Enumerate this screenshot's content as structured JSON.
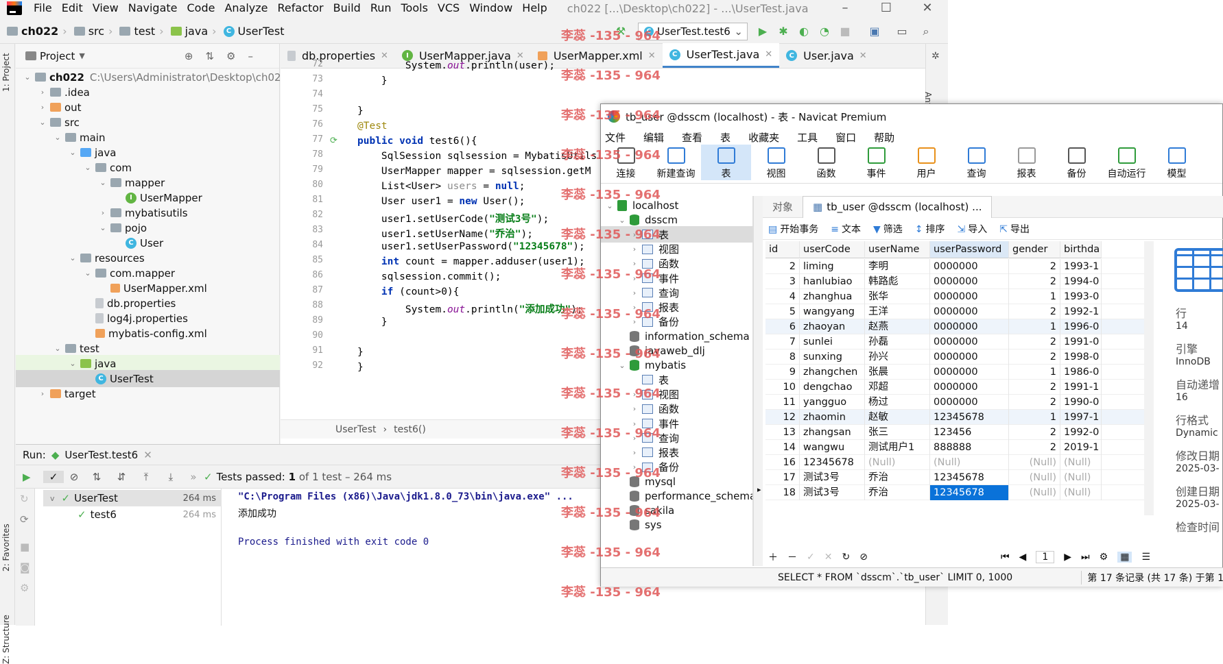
{
  "ide": {
    "menu": [
      "File",
      "Edit",
      "View",
      "Navigate",
      "Code",
      "Analyze",
      "Refactor",
      "Build",
      "Run",
      "Tools",
      "VCS",
      "Window",
      "Help"
    ],
    "window_title": "ch022 [...\\Desktop\\ch022] - ...\\UserTest.java",
    "breadcrumb": [
      "ch022",
      "src",
      "test",
      "java",
      "UserTest"
    ],
    "run_config": "UserTest.test6",
    "project_label": "Project",
    "vertical_tabs": {
      "project": "1: Project",
      "favorites": "2: Favorites",
      "structure": "Z: Structure",
      "ant": "Ant"
    },
    "tree": [
      {
        "label": "ch022",
        "extra": "C:\\Users\\Administrator\\Desktop\\ch022",
        "indent": 0,
        "arrow": "v",
        "icon": "folder"
      },
      {
        "label": ".idea",
        "indent": 1,
        "arrow": ">",
        "icon": "folder"
      },
      {
        "label": "out",
        "indent": 1,
        "arrow": ">",
        "icon": "folder-orange"
      },
      {
        "label": "src",
        "indent": 1,
        "arrow": "v",
        "icon": "folder"
      },
      {
        "label": "main",
        "indent": 2,
        "arrow": "v",
        "icon": "folder"
      },
      {
        "label": "java",
        "indent": 3,
        "arrow": "v",
        "icon": "folder-blue"
      },
      {
        "label": "com",
        "indent": 4,
        "arrow": "v",
        "icon": "folder"
      },
      {
        "label": "mapper",
        "indent": 5,
        "arrow": "v",
        "icon": "folder"
      },
      {
        "label": "UserMapper",
        "indent": 6,
        "arrow": "",
        "icon": "interface"
      },
      {
        "label": "mybatisutils",
        "indent": 5,
        "arrow": ">",
        "icon": "folder"
      },
      {
        "label": "pojo",
        "indent": 5,
        "arrow": "v",
        "icon": "folder"
      },
      {
        "label": "User",
        "indent": 6,
        "arrow": "",
        "icon": "class"
      },
      {
        "label": "resources",
        "indent": 3,
        "arrow": "v",
        "icon": "folder"
      },
      {
        "label": "com.mapper",
        "indent": 4,
        "arrow": "v",
        "icon": "folder"
      },
      {
        "label": "UserMapper.xml",
        "indent": 5,
        "arrow": "",
        "icon": "xml"
      },
      {
        "label": "db.properties",
        "indent": 4,
        "arrow": "",
        "icon": "file"
      },
      {
        "label": "log4j.properties",
        "indent": 4,
        "arrow": "",
        "icon": "file"
      },
      {
        "label": "mybatis-config.xml",
        "indent": 4,
        "arrow": "",
        "icon": "xml"
      },
      {
        "label": "test",
        "indent": 2,
        "arrow": "v",
        "icon": "folder"
      },
      {
        "label": "java",
        "indent": 3,
        "arrow": "v",
        "icon": "folder-green"
      },
      {
        "label": "UserTest",
        "indent": 4,
        "arrow": "",
        "icon": "class"
      },
      {
        "label": "target",
        "indent": 1,
        "arrow": ">",
        "icon": "folder-orange"
      }
    ],
    "tabs": [
      {
        "label": "db.properties",
        "icon": "file"
      },
      {
        "label": "UserMapper.java",
        "icon": "interface"
      },
      {
        "label": "UserMapper.xml",
        "icon": "xml"
      },
      {
        "label": "UserTest.java",
        "icon": "class",
        "active": true
      },
      {
        "label": "User.java",
        "icon": "class"
      }
    ],
    "line_numbers": [
      "72",
      "73",
      "74",
      "75",
      "76",
      "77",
      "78",
      "79",
      "80",
      "81",
      "82",
      "83",
      "84",
      "85",
      "86",
      "87",
      "88",
      "89",
      "90",
      "91",
      "92"
    ],
    "code_lines": [
      "        System.out.println(user);",
      "    }",
      "",
      "}",
      "@Test",
      "public void test6(){",
      "    SqlSession sqlsession = MybatisUtils.",
      "    UserMapper mapper = sqlsession.getM",
      "    List<User> users = null;",
      "    User user1 = new User();",
      "    user1.setUserCode(\"测试3号\");",
      "    user1.setUserName(\"乔治\");",
      "    user1.setUserPassword(\"12345678\");",
      "    int count = mapper.adduser(user1);",
      "    sqlsession.commit();",
      "    if (count>0){",
      "        System.out.println(\"添加成功\");",
      "    }",
      "",
      "}",
      "}"
    ],
    "editor_crumb": [
      "UserTest",
      "test6()"
    ],
    "run": {
      "label": "Run:",
      "tab": "UserTest.test6",
      "status": "Tests passed:",
      "status_count": "1",
      "status_rest": "of 1 test – 264 ms",
      "tree": [
        {
          "label": "UserTest",
          "time": "264 ms"
        },
        {
          "label": "test6",
          "time": "264 ms"
        }
      ],
      "output": [
        "\"C:\\Program Files (x86)\\Java\\jdk1.8.0_73\\bin\\java.exe\" ...",
        "添加成功",
        "",
        "Process finished with exit code 0"
      ]
    }
  },
  "navicat": {
    "title": "tb_user @dsscm (localhost) - 表 - Navicat Premium",
    "menu": [
      "文件",
      "编辑",
      "查看",
      "表",
      "收藏夹",
      "工具",
      "窗口",
      "帮助"
    ],
    "toolbar": [
      "连接",
      "新建查询",
      "表",
      "视图",
      "函数",
      "事件",
      "用户",
      "查询",
      "报表",
      "备份",
      "自动运行",
      "模型"
    ],
    "tree": [
      {
        "label": "localhost",
        "indent": 0,
        "arrow": "v",
        "icon": "server"
      },
      {
        "label": "dsscm",
        "indent": 1,
        "arrow": "v",
        "icon": "db-green"
      },
      {
        "label": "表",
        "indent": 2,
        "arrow": ">",
        "icon": "table",
        "selected": true
      },
      {
        "label": "视图",
        "indent": 2,
        "arrow": ">",
        "icon": "view"
      },
      {
        "label": "函数",
        "indent": 2,
        "arrow": ">",
        "icon": "func"
      },
      {
        "label": "事件",
        "indent": 2,
        "arrow": ">",
        "icon": "event"
      },
      {
        "label": "查询",
        "indent": 2,
        "arrow": ">",
        "icon": "query"
      },
      {
        "label": "报表",
        "indent": 2,
        "arrow": ">",
        "icon": "report"
      },
      {
        "label": "备份",
        "indent": 2,
        "arrow": ">",
        "icon": "backup"
      },
      {
        "label": "information_schema",
        "indent": 1,
        "arrow": "",
        "icon": "db"
      },
      {
        "label": "javaweb_dlj",
        "indent": 1,
        "arrow": "",
        "icon": "db"
      },
      {
        "label": "mybatis",
        "indent": 1,
        "arrow": "v",
        "icon": "db-green"
      },
      {
        "label": "表",
        "indent": 2,
        "arrow": "",
        "icon": "table"
      },
      {
        "label": "视图",
        "indent": 2,
        "arrow": ">",
        "icon": "view"
      },
      {
        "label": "函数",
        "indent": 2,
        "arrow": ">",
        "icon": "func"
      },
      {
        "label": "事件",
        "indent": 2,
        "arrow": ">",
        "icon": "event"
      },
      {
        "label": "查询",
        "indent": 2,
        "arrow": ">",
        "icon": "query"
      },
      {
        "label": "报表",
        "indent": 2,
        "arrow": ">",
        "icon": "report"
      },
      {
        "label": "备份",
        "indent": 2,
        "arrow": ">",
        "icon": "backup"
      },
      {
        "label": "mysql",
        "indent": 1,
        "arrow": "",
        "icon": "db"
      },
      {
        "label": "performance_schema",
        "indent": 1,
        "arrow": "",
        "icon": "db"
      },
      {
        "label": "sakila",
        "indent": 1,
        "arrow": "",
        "icon": "db"
      },
      {
        "label": "sys",
        "indent": 1,
        "arrow": "",
        "icon": "db"
      }
    ],
    "obj_tabs": [
      "对象",
      "tb_user @dsscm (localhost) ..."
    ],
    "actions": [
      "开始事务",
      "文本",
      "筛选",
      "排序",
      "导入",
      "导出"
    ],
    "columns": [
      "id",
      "userCode",
      "userName",
      "userPassword",
      "gender",
      "birthda"
    ],
    "rows": [
      [
        "2",
        "liming",
        "李明",
        "0000000",
        "2",
        "1993-1"
      ],
      [
        "3",
        "hanlubiao",
        "韩路彪",
        "0000000",
        "2",
        "1994-0"
      ],
      [
        "4",
        "zhanghua",
        "张华",
        "0000000",
        "1",
        "1993-0"
      ],
      [
        "5",
        "wangyang",
        "王洋",
        "0000000",
        "2",
        "1992-1"
      ],
      [
        "6",
        "zhaoyan",
        "赵燕",
        "0000000",
        "1",
        "1996-0"
      ],
      [
        "7",
        "sunlei",
        "孙磊",
        "0000000",
        "2",
        "1991-0"
      ],
      [
        "8",
        "sunxing",
        "孙兴",
        "0000000",
        "2",
        "1998-0"
      ],
      [
        "9",
        "zhangchen",
        "张晨",
        "0000000",
        "1",
        "1986-0"
      ],
      [
        "10",
        "dengchao",
        "邓超",
        "0000000",
        "2",
        "1991-1"
      ],
      [
        "11",
        "yangguo",
        "杨过",
        "0000000",
        "2",
        "1990-0"
      ],
      [
        "12",
        "zhaomin",
        "赵敏",
        "12345678",
        "1",
        "1997-1"
      ],
      [
        "13",
        "zhangsan",
        "张三",
        "123456",
        "2",
        "1992-0"
      ],
      [
        "14",
        "wangwu",
        "测试用户1",
        "888888",
        "2",
        "2019-1"
      ],
      [
        "16",
        "12345678",
        "(Null)",
        "(Null)",
        "(Null)",
        "(Null)"
      ],
      [
        "17",
        "测试3号",
        "乔治",
        "12345678",
        "(Null)",
        "(Null)"
      ],
      [
        "18",
        "测试3号",
        "乔治",
        "12345678",
        "(Null)",
        "(Null)"
      ]
    ],
    "page": "1",
    "side": [
      {
        "label": "行",
        "value": "14"
      },
      {
        "label": "引擎",
        "value": "InnoDB"
      },
      {
        "label": "自动递增",
        "value": "16"
      },
      {
        "label": "行格式",
        "value": "Dynamic"
      },
      {
        "label": "修改日期",
        "value": "2025-03-"
      },
      {
        "label": "创建日期",
        "value": "2025-03-"
      },
      {
        "label": "检查时间",
        "value": ""
      }
    ],
    "sql": "SELECT * FROM `dsscm`.`tb_user` LIMIT 0, 1000",
    "record": "第 17 条记录 (共 17 条) 于第 1"
  },
  "watermark": "李蕊 -135 - 964"
}
